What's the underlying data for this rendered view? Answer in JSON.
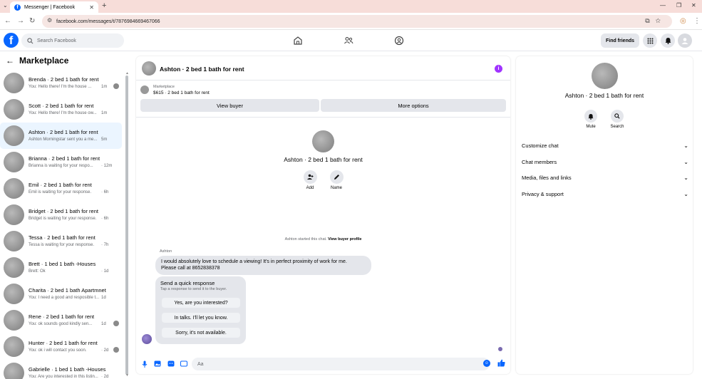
{
  "browser": {
    "tab_title": "Messenger | Facebook",
    "url": "facebook.com/messages/t/7876984669467066"
  },
  "fb_header": {
    "search_placeholder": "Search Facebook",
    "find_friends": "Find friends"
  },
  "left": {
    "title": "Marketplace",
    "conversations": [
      {
        "title": "Brenda · 2 bed 1 bath for rent",
        "snippet": "You: Hello there! I'm the house ...",
        "time": "1m",
        "seen": true
      },
      {
        "title": "Scott · 2 bed 1 bath for rent",
        "snippet": "You: Hello there! I'm the house ow...",
        "time": "1m",
        "seen": false
      },
      {
        "title": "Ashton · 2 bed 1 bath for rent",
        "snippet": "Ashton Morningstar sent you a me...",
        "time": "5m",
        "seen": false
      },
      {
        "title": "Brianna · 2 bed 1 bath for rent",
        "snippet": "Brianna is waiting for your respo...",
        "time": "· 12m",
        "seen": false
      },
      {
        "title": "Emil · 2 bed 1 bath for rent",
        "snippet": "Emil is waiting for your response.",
        "time": "· 6h",
        "seen": false
      },
      {
        "title": "Bridget · 2 bed 1 bath for rent",
        "snippet": "Bridget is waiting for your response.",
        "time": "· 6h",
        "seen": false
      },
      {
        "title": "Tessa · 2 bed 1 bath for rent",
        "snippet": "Tessa is waiting for your response.",
        "time": "· 7h",
        "seen": false
      },
      {
        "title": "Brett · 1 bed 1 bath -Houses",
        "snippet": "Brett: Ok",
        "time": "· 1d",
        "seen": false
      },
      {
        "title": "Charita · 2 bed 1 bath Apartmnet",
        "snippet": "You: I need a good and resposible t...",
        "time": "1d",
        "seen": false
      },
      {
        "title": "Rene · 2 bed 1 bath for rent",
        "snippet": "You: ok sounds good kindly sen...",
        "time": "1d",
        "seen": true
      },
      {
        "title": "Hunter · 2 bed 1 bath for rent",
        "snippet": "You: ok i will contact you soon.",
        "time": "· 2d",
        "seen": true
      },
      {
        "title": "Gabrielle · 1 bed 1 bath -Houses",
        "snippet": "You: Are you interested in this listin...",
        "time": "· 2d",
        "seen": false
      }
    ]
  },
  "chat": {
    "header_title": "Ashton · 2 bed 1 bath for rent",
    "marketplace_label": "Marketplace",
    "listing": "$615 · 2 bed 1 bath for rent",
    "view_buyer": "View buyer",
    "more_options": "More options",
    "profile_title": "Ashton · 2 bed 1 bath for rent",
    "add_label": "Add",
    "name_label": "Name",
    "started_text": "Ashton started this chat.",
    "view_buyer_profile": "View buyer profile",
    "sender": "Ashton",
    "message_line1": "I would absolutely love to schedule a viewing! It's in perfect proximity of work for me.",
    "message_line2": "Please call at 8652838378",
    "quick_title": "Send a quick response",
    "quick_sub": "Tap a response to send it to the buyer.",
    "quick_replies": [
      "Yes, are you interested?",
      "In talks. I'll let you know.",
      "Sorry, it's not available."
    ],
    "composer_placeholder": "Aa"
  },
  "right": {
    "title": "Ashton · 2 bed 1 bath for rent",
    "mute": "Mute",
    "search": "Search",
    "rows": [
      "Customize chat",
      "Chat members",
      "Media, files and links",
      "Privacy & support"
    ]
  }
}
